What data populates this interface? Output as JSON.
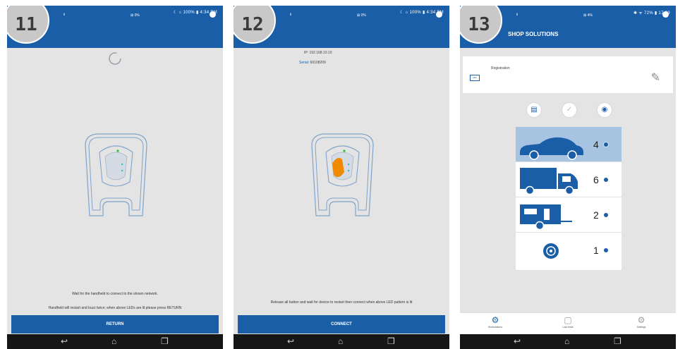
{
  "colors": {
    "primary": "#1b5ea8",
    "screen_bg": "#e4e4e4",
    "accent_orange": "#f08a00",
    "led_green": "#2fbf3a"
  },
  "screen11": {
    "badge": "11",
    "status_right": "☾ ⌂ 100% ▮ 4:34 PM",
    "appbar_small": "ii",
    "appbar_wifi": "⊞ 0%",
    "message_line1": "Wait for the handheld to connect to the shown network.",
    "message_line2": "Handheld will restart and buzz twice; when above LEDs are lit please press RETURN",
    "button_label": "RETURN",
    "icons": {
      "spinner": "loading-spinner-icon",
      "device": "handheld-device-icon"
    }
  },
  "screen12": {
    "badge": "12",
    "status_right": "☾ ⌂ 100% ▮ 4:34 PM",
    "appbar_small": "ii",
    "appbar_wifi": "⊞ 0%",
    "ip_label": "IP:",
    "ip_value": "192.168.10.10",
    "serial_label": "Serial:",
    "serial_value": "60108209",
    "message": "Release all button and wait for device to restart then connect when above LED pattern is lit",
    "button_label": "CONNECT"
  },
  "screen13": {
    "badge": "13",
    "status_right": "✱ ᯤ 72% ▮ 17:39",
    "appbar_small": "ii",
    "appbar_wifi": "⊞ 4%",
    "title": "SHOP SOLUTIONS",
    "registration_label": "Registration",
    "registration_icon_text": "ABC",
    "vehicles": [
      {
        "name": "car",
        "count": "4",
        "selected": true
      },
      {
        "name": "truck",
        "count": "6",
        "selected": false
      },
      {
        "name": "caravan",
        "count": "2",
        "selected": false
      },
      {
        "name": "wheel",
        "count": "1",
        "selected": false
      }
    ],
    "tabs": [
      {
        "label": "Workstations",
        "icon": "workstation-icon"
      },
      {
        "label": "Last tests",
        "icon": "clipboard-icon"
      },
      {
        "label": "Settings",
        "icon": "settings-icon"
      }
    ]
  }
}
